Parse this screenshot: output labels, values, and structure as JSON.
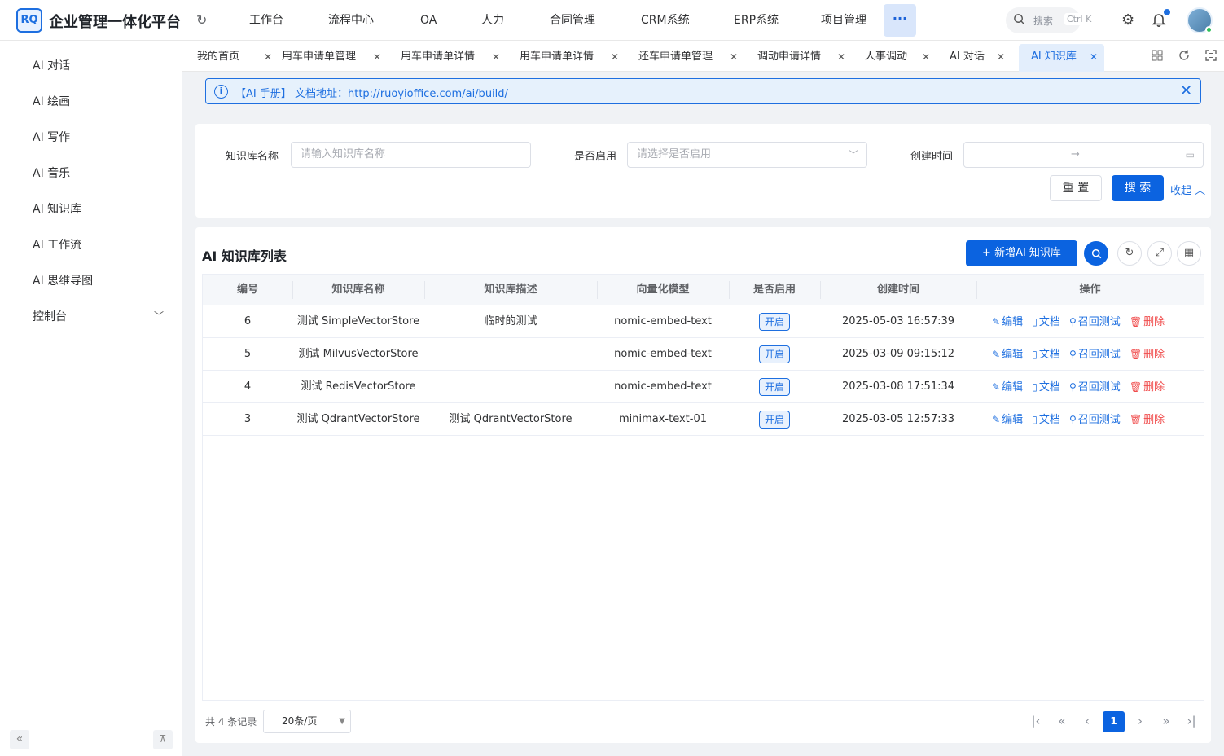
{
  "app": {
    "logo_text": "RQ",
    "title": "企业管理一体化平台"
  },
  "topnav": [
    "工作台",
    "流程中心",
    "OA",
    "人力",
    "合同管理",
    "CRM系统",
    "ERP系统",
    "项目管理"
  ],
  "header": {
    "more": "···",
    "search_label": "搜索",
    "search_shortcut": "Ctrl K"
  },
  "sidebar": {
    "items": [
      "AI 对话",
      "AI 绘画",
      "AI 写作",
      "AI 音乐",
      "AI 知识库",
      "AI 工作流",
      "AI 思维导图",
      "控制台"
    ]
  },
  "tabs": [
    {
      "label": "我的首页"
    },
    {
      "label": "用车申请单管理"
    },
    {
      "label": "用车申请单详情"
    },
    {
      "label": "用车申请单详情"
    },
    {
      "label": "还车申请单管理"
    },
    {
      "label": "调动申请详情"
    },
    {
      "label": "人事调动"
    },
    {
      "label": "AI 对话"
    },
    {
      "label": "AI 知识库"
    }
  ],
  "notice": {
    "text": "【AI 手册】 文档地址：http://ruoyioffice.com/ai/build/"
  },
  "filters": {
    "name_label": "知识库名称",
    "name_placeholder": "请输入知识库名称",
    "enabled_label": "是否启用",
    "enabled_placeholder": "请选择是否启用",
    "created_label": "创建时间",
    "range_sep": "→",
    "reset": "重 置",
    "search": "搜 索",
    "collapse": "收起"
  },
  "list": {
    "title": "AI 知识库列表",
    "add_button": "+ 新增AI 知识库",
    "columns": [
      "编号",
      "知识库名称",
      "知识库描述",
      "向量化模型",
      "是否启用",
      "创建时间",
      "操作"
    ],
    "rows": [
      {
        "id": "6",
        "name": "测试 SimpleVectorStore",
        "desc": "临时的测试",
        "model": "nomic-embed-text",
        "enabled": "开启",
        "created": "2025-05-03 16:57:39"
      },
      {
        "id": "5",
        "name": "测试 MilvusVectorStore",
        "desc": "",
        "model": "nomic-embed-text",
        "enabled": "开启",
        "created": "2025-03-09 09:15:12"
      },
      {
        "id": "4",
        "name": "测试 RedisVectorStore",
        "desc": "",
        "model": "nomic-embed-text",
        "enabled": "开启",
        "created": "2025-03-08 17:51:34"
      },
      {
        "id": "3",
        "name": "测试 QdrantVectorStore",
        "desc": "测试 QdrantVectorStore",
        "model": "minimax-text-01",
        "enabled": "开启",
        "created": "2025-03-05 12:57:33"
      }
    ],
    "actions": {
      "edit": "编辑",
      "docs": "文档",
      "recall": "召回测试",
      "delete": "删除"
    }
  },
  "pagination": {
    "total": "共 4 条记录",
    "page_size": "20条/页",
    "current": "1"
  },
  "colors": {
    "primary": "#0b63e0",
    "danger": "#f04b4b"
  }
}
